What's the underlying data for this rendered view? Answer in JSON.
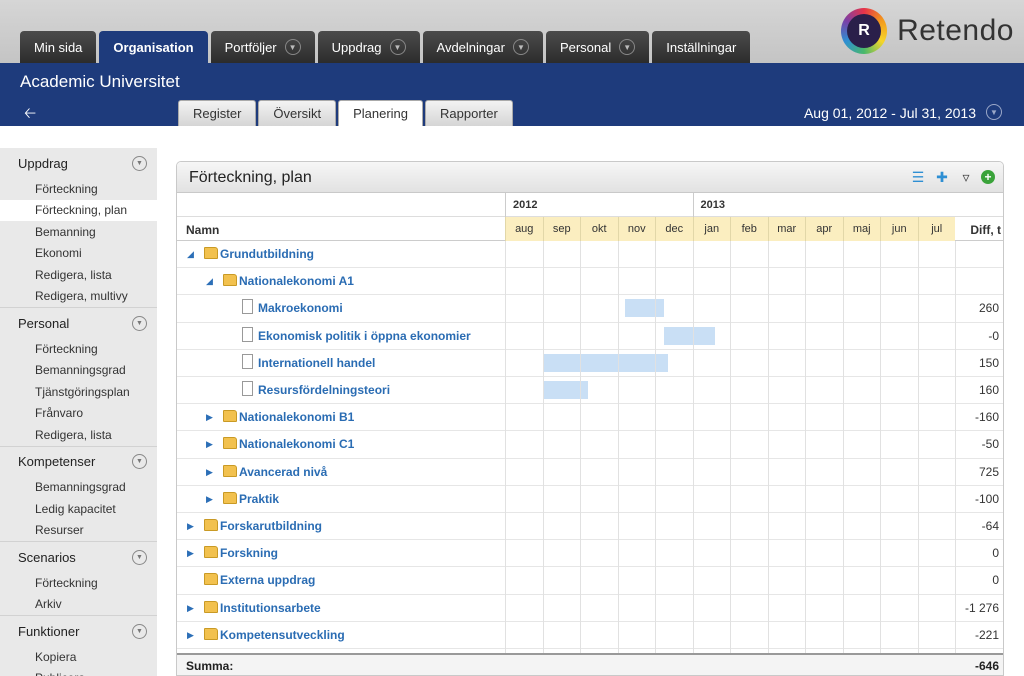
{
  "top_tabs": [
    {
      "label": "Min sida",
      "dropdown": false,
      "active": false
    },
    {
      "label": "Organisation",
      "dropdown": false,
      "active": true
    },
    {
      "label": "Portföljer",
      "dropdown": true,
      "active": false
    },
    {
      "label": "Uppdrag",
      "dropdown": true,
      "active": false
    },
    {
      "label": "Avdelningar",
      "dropdown": true,
      "active": false
    },
    {
      "label": "Personal",
      "dropdown": true,
      "active": false
    },
    {
      "label": "Inställningar",
      "dropdown": false,
      "active": false
    }
  ],
  "logo": {
    "text": "Retendo"
  },
  "header": {
    "org_name": "Academic Universitet",
    "date_range": "Aug 01, 2012 - Jul 31, 2013",
    "sub_tabs": [
      {
        "label": "Register",
        "active": false
      },
      {
        "label": "Översikt",
        "active": false
      },
      {
        "label": "Planering",
        "active": true
      },
      {
        "label": "Rapporter",
        "active": false
      }
    ]
  },
  "sidebar": [
    {
      "title": "Uppdrag",
      "items": [
        {
          "label": "Förteckning",
          "selected": false
        },
        {
          "label": "Förteckning, plan",
          "selected": true
        },
        {
          "label": "Bemanning",
          "selected": false
        },
        {
          "label": "Ekonomi",
          "selected": false
        },
        {
          "label": "Redigera, lista",
          "selected": false
        },
        {
          "label": "Redigera, multivy",
          "selected": false
        }
      ]
    },
    {
      "title": "Personal",
      "items": [
        {
          "label": "Förteckning",
          "selected": false
        },
        {
          "label": "Bemanningsgrad",
          "selected": false
        },
        {
          "label": "Tjänstgöringsplan",
          "selected": false
        },
        {
          "label": "Frånvaro",
          "selected": false
        },
        {
          "label": "Redigera, lista",
          "selected": false
        }
      ]
    },
    {
      "title": "Kompetenser",
      "items": [
        {
          "label": "Bemanningsgrad",
          "selected": false
        },
        {
          "label": "Ledig kapacitet",
          "selected": false
        },
        {
          "label": "Resurser",
          "selected": false
        }
      ]
    },
    {
      "title": "Scenarios",
      "items": [
        {
          "label": "Förteckning",
          "selected": false
        },
        {
          "label": "Arkiv",
          "selected": false
        }
      ]
    },
    {
      "title": "Funktioner",
      "items": [
        {
          "label": "Kopiera",
          "selected": false
        },
        {
          "label": "Publicera",
          "selected": false
        }
      ]
    }
  ],
  "panel": {
    "title": "Förteckning, plan",
    "col_name": "Namn",
    "col_diff": "Diff, t",
    "years": [
      "2012",
      "2013"
    ],
    "months": [
      "aug",
      "sep",
      "okt",
      "nov",
      "dec",
      "jan",
      "feb",
      "mar",
      "apr",
      "maj",
      "jun",
      "jul"
    ],
    "rows": [
      {
        "name": "Grundutbildning",
        "level": 0,
        "type": "folder",
        "expand": "open",
        "diff": "",
        "bar": null
      },
      {
        "name": "Nationalekonomi A1",
        "level": 1,
        "type": "folder",
        "expand": "open",
        "diff": "",
        "bar": null
      },
      {
        "name": "Makroekonomi",
        "level": 2,
        "type": "doc",
        "expand": "none",
        "diff": "260",
        "bar": {
          "start": 3.2,
          "end": 4.25
        }
      },
      {
        "name": "Ekonomisk politik i öppna ekonomier",
        "level": 2,
        "type": "doc",
        "expand": "none",
        "diff": "-0",
        "bar": {
          "start": 4.25,
          "end": 5.6
        }
      },
      {
        "name": "Internationell handel",
        "level": 2,
        "type": "doc",
        "expand": "none",
        "diff": "150",
        "bar": {
          "start": 1.05,
          "end": 4.35
        }
      },
      {
        "name": "Resursfördelningsteori",
        "level": 2,
        "type": "doc",
        "expand": "none",
        "diff": "160",
        "bar": {
          "start": 1.05,
          "end": 2.2
        }
      },
      {
        "name": "Nationalekonomi B1",
        "level": 1,
        "type": "folder",
        "expand": "closed",
        "diff": "-160",
        "bar": null
      },
      {
        "name": "Nationalekonomi C1",
        "level": 1,
        "type": "folder",
        "expand": "closed",
        "diff": "-50",
        "bar": null
      },
      {
        "name": "Avancerad nivå",
        "level": 1,
        "type": "folder",
        "expand": "closed",
        "diff": "725",
        "bar": null
      },
      {
        "name": "Praktik",
        "level": 1,
        "type": "folder",
        "expand": "closed",
        "diff": "-100",
        "bar": null
      },
      {
        "name": "Forskarutbildning",
        "level": 0,
        "type": "folder",
        "expand": "closed",
        "diff": "-64",
        "bar": null
      },
      {
        "name": "Forskning",
        "level": 0,
        "type": "folder",
        "expand": "closed",
        "diff": "0",
        "bar": null
      },
      {
        "name": "Externa uppdrag",
        "level": 0,
        "type": "folder",
        "expand": "none",
        "diff": "0",
        "bar": null
      },
      {
        "name": "Institutionsarbete",
        "level": 0,
        "type": "folder",
        "expand": "closed",
        "diff": "-1 276",
        "bar": null
      },
      {
        "name": "Kompetensutveckling",
        "level": 0,
        "type": "folder",
        "expand": "closed",
        "diff": "-221",
        "bar": null
      }
    ],
    "sum_label": "Summa:",
    "sum_value": "-646"
  }
}
